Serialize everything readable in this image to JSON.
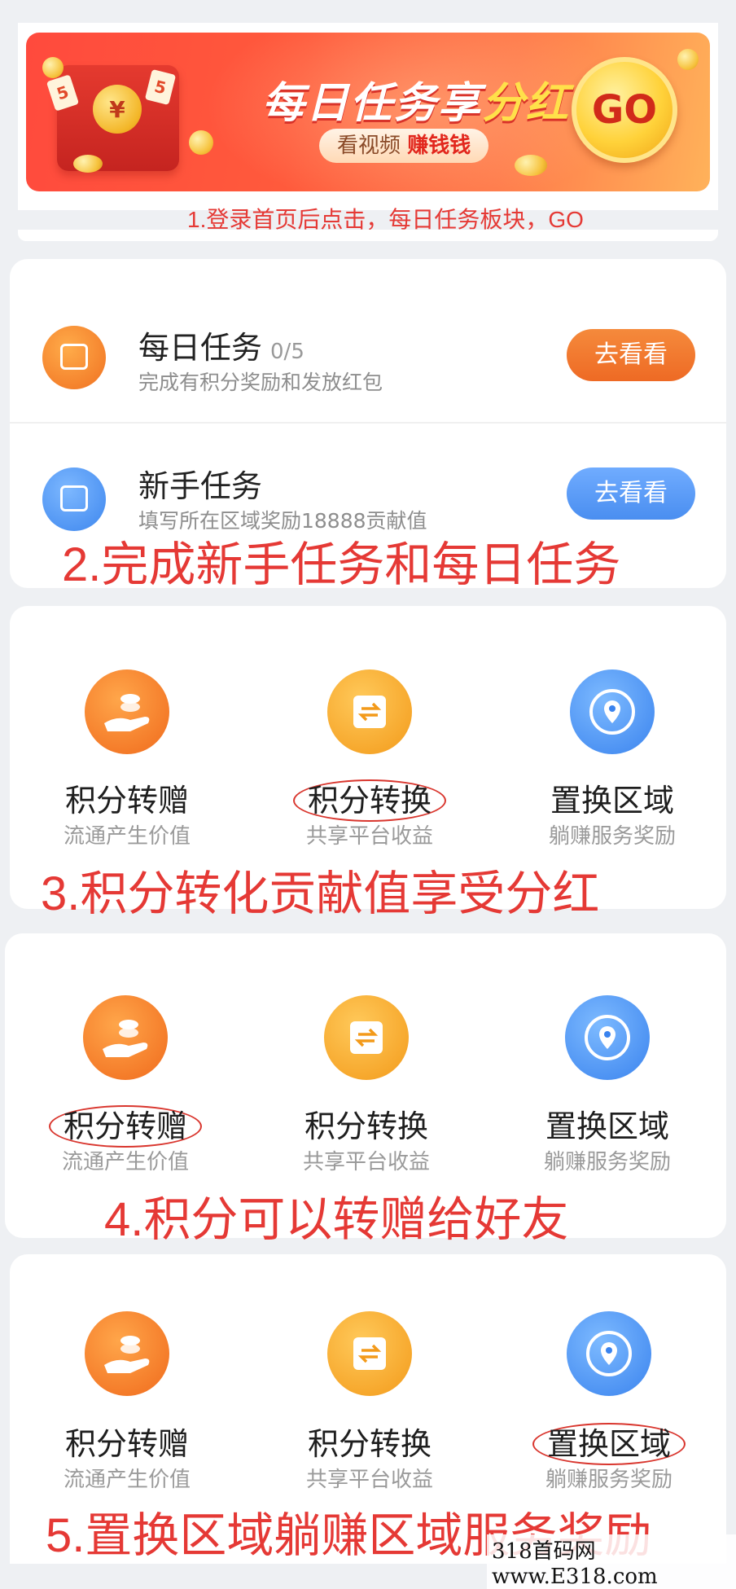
{
  "banner": {
    "title_main": "每日任务享",
    "title_highlight": "分红",
    "subtitle_normal": "看视频 ",
    "subtitle_emphasis": "赚钱钱",
    "go_label": "GO",
    "envelope_symbol": "¥",
    "card_digit": "5"
  },
  "steps": {
    "s1": "1.登录首页后点击，每日任务板块，GO",
    "s2": "2.完成新手任务和每日任务",
    "s3": "3.积分转化贡献值享受分红",
    "s4": "4.积分可以转赠给好友",
    "s5": "5.置换区域躺赚区域服务奖励"
  },
  "tasks": [
    {
      "title": "每日任务",
      "count": "0/5",
      "desc": "完成有积分奖励和发放红包",
      "button": "去看看",
      "color": "#ee6a24"
    },
    {
      "title": "新手任务",
      "count": "",
      "desc": "填写所在区域奖励18888贡献值",
      "button": "去看看",
      "color": "#4a8ef0"
    }
  ],
  "grid": {
    "transfer_title": "积分转赠",
    "transfer_desc": "流通产生价值",
    "exchange_title": "积分转换",
    "exchange_desc": "共享平台收益",
    "region_title": "置换区域",
    "region_desc": "躺赚服务奖励"
  },
  "watermark": "318首码网 www.E318.com"
}
